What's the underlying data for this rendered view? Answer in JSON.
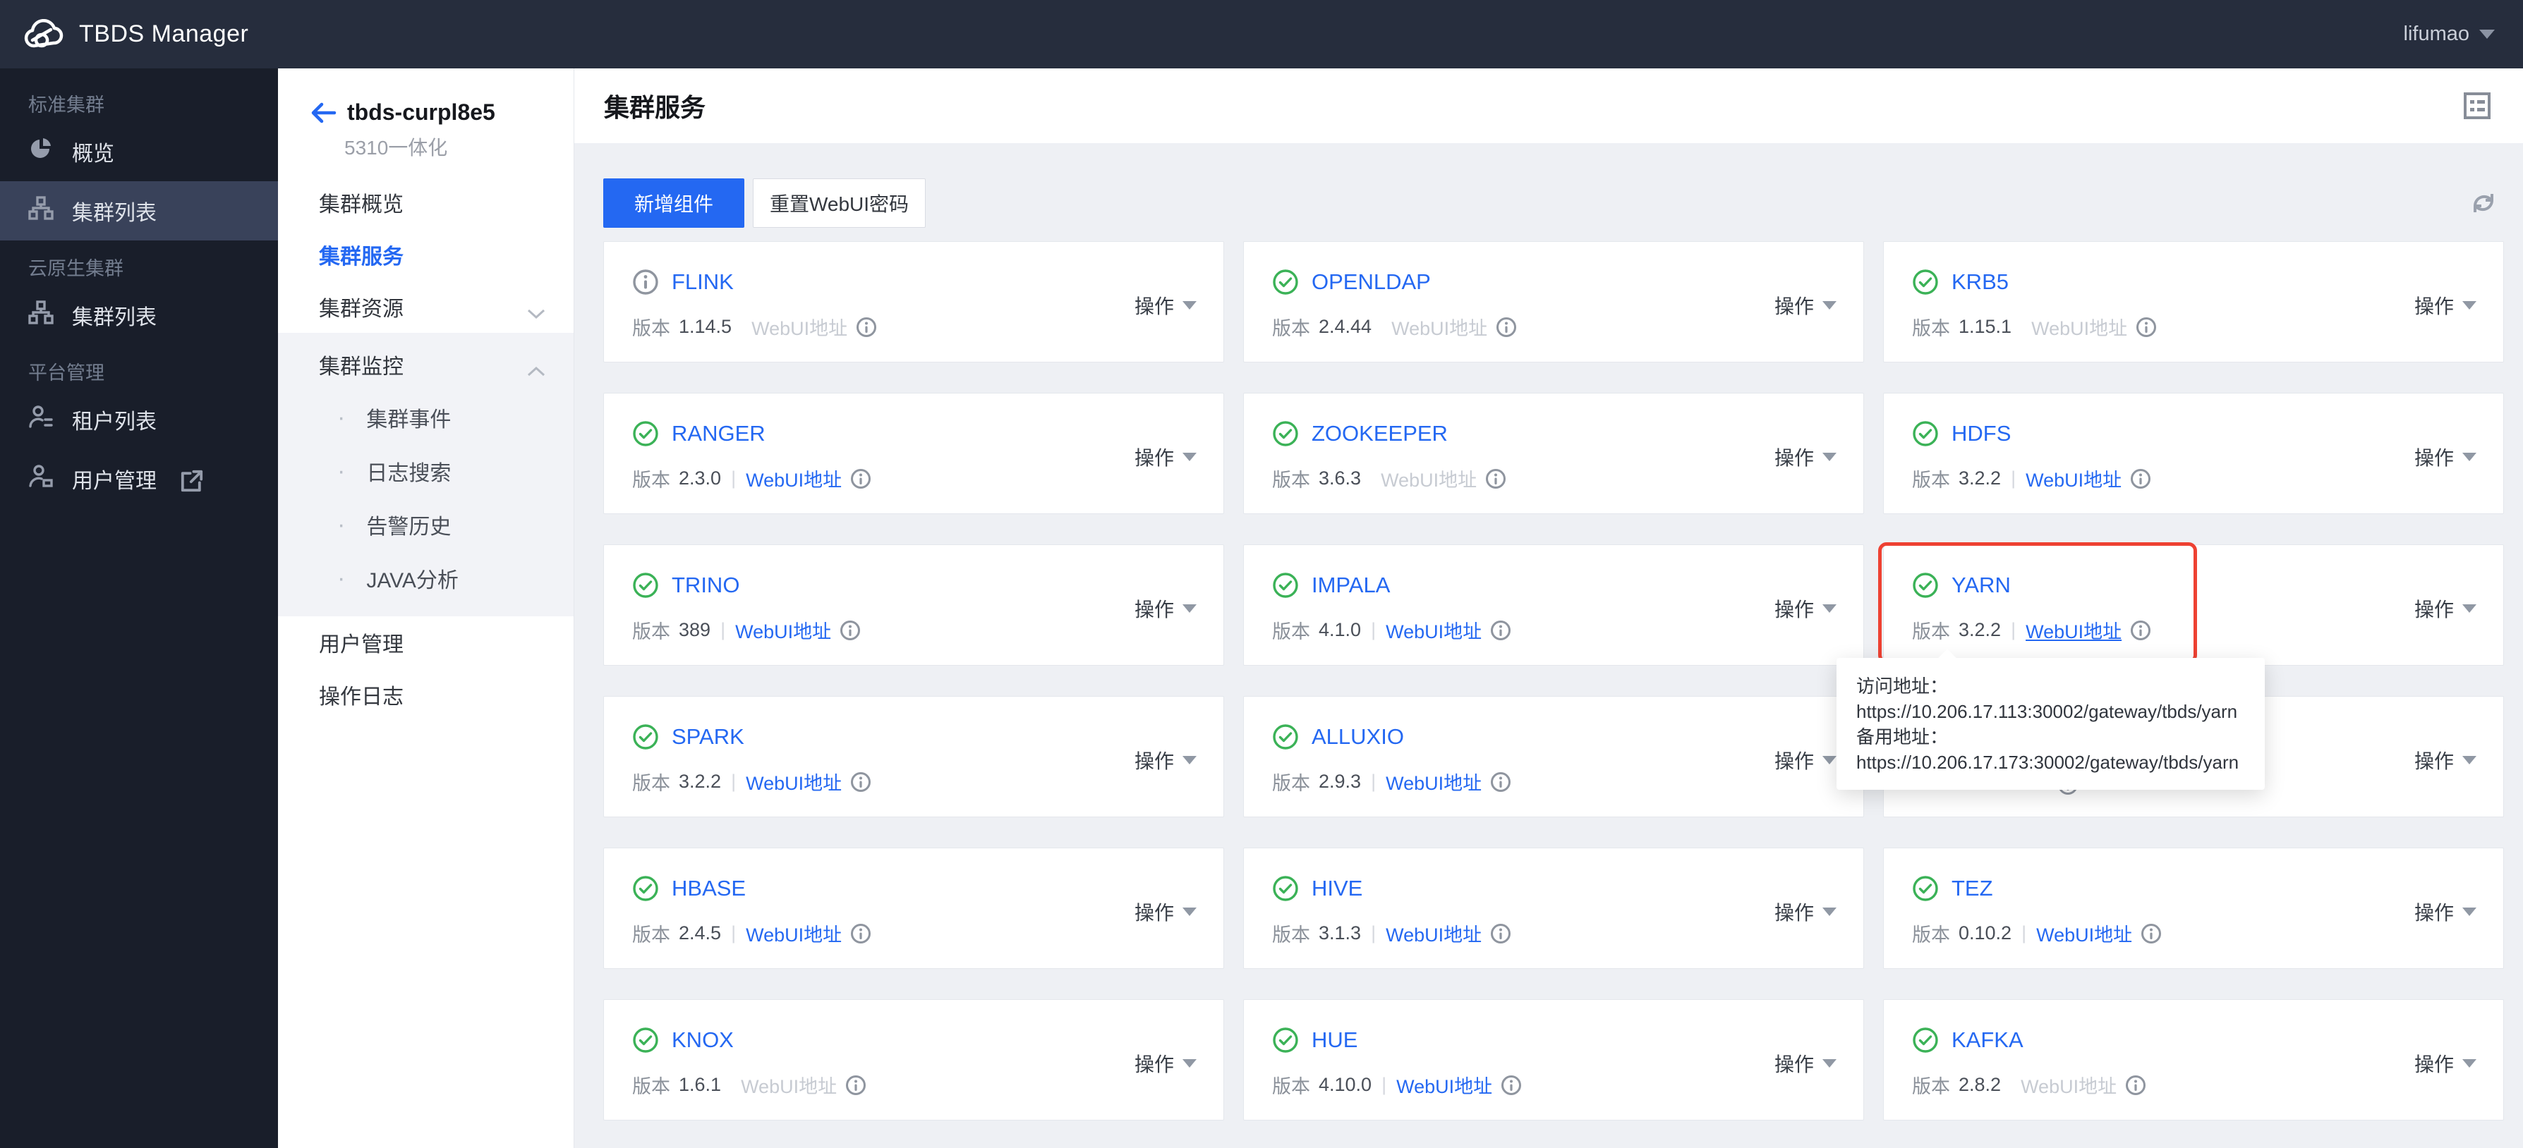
{
  "topbar": {
    "brand": "TBDS Manager",
    "user": "lifumao"
  },
  "sidebar": {
    "sections": [
      {
        "label": "标准集群",
        "items": [
          {
            "label": "概览",
            "icon": "pie-chart-icon",
            "active": false
          },
          {
            "label": "集群列表",
            "icon": "cluster-icon",
            "active": true
          }
        ]
      },
      {
        "label": "云原生集群",
        "items": [
          {
            "label": "集群列表",
            "icon": "cluster-icon",
            "active": false
          }
        ]
      },
      {
        "label": "平台管理",
        "items": [
          {
            "label": "租户列表",
            "icon": "tenant-icon",
            "active": false
          },
          {
            "label": "用户管理",
            "icon": "user-icon",
            "active": false,
            "external": true
          }
        ]
      }
    ]
  },
  "subsidebar": {
    "cluster_name": "tbds-curpl8e5",
    "cluster_subtitle": "5310一体化",
    "items": [
      {
        "label": "集群概览",
        "type": "item",
        "active": false
      },
      {
        "label": "集群服务",
        "type": "item",
        "active": true
      },
      {
        "label": "集群资源",
        "type": "group-collapsed"
      },
      {
        "label": "集群监控",
        "type": "group-expanded",
        "children": [
          "集群事件",
          "日志搜索",
          "告警历史",
          "JAVA分析"
        ]
      },
      {
        "label": "用户管理",
        "type": "item",
        "active": false
      },
      {
        "label": "操作日志",
        "type": "item",
        "active": false
      }
    ]
  },
  "main": {
    "title": "集群服务",
    "add_button": "新增组件",
    "reset_button": "重置WebUI密码",
    "version_label": "版本",
    "webui_label": "WebUI地址",
    "action_label": "操作",
    "cards": [
      {
        "name": "FLINK",
        "status": "info",
        "version": "1.14.5",
        "webui_link": false
      },
      {
        "name": "OPENLDAP",
        "status": "ok",
        "version": "2.4.44",
        "webui_link": false
      },
      {
        "name": "KRB5",
        "status": "ok",
        "version": "1.15.1",
        "webui_link": false
      },
      {
        "name": "RANGER",
        "status": "ok",
        "version": "2.3.0",
        "webui_link": true
      },
      {
        "name": "ZOOKEEPER",
        "status": "ok",
        "version": "3.6.3",
        "webui_link": false
      },
      {
        "name": "HDFS",
        "status": "ok",
        "version": "3.2.2",
        "webui_link": true
      },
      {
        "name": "TRINO",
        "status": "ok",
        "version": "389",
        "webui_link": true
      },
      {
        "name": "IMPALA",
        "status": "ok",
        "version": "4.1.0",
        "webui_link": true
      },
      {
        "name": "YARN",
        "status": "ok",
        "version": "3.2.2",
        "webui_link": true,
        "webui_underline": true,
        "highlighted": true
      },
      {
        "name": "SPARK",
        "status": "ok",
        "version": "3.2.2",
        "webui_link": true
      },
      {
        "name": "ALLUXIO",
        "status": "ok",
        "version": "2.9.3",
        "webui_link": true
      },
      {
        "name": "",
        "status": "covered",
        "version": "",
        "webui_link": false
      },
      {
        "name": "HBASE",
        "status": "ok",
        "version": "2.4.5",
        "webui_link": true
      },
      {
        "name": "HIVE",
        "status": "ok",
        "version": "3.1.3",
        "webui_link": true
      },
      {
        "name": "TEZ",
        "status": "ok",
        "version": "0.10.2",
        "webui_link": true
      },
      {
        "name": "KNOX",
        "status": "ok",
        "version": "1.6.1",
        "webui_link": false
      },
      {
        "name": "HUE",
        "status": "ok",
        "version": "4.10.0",
        "webui_link": true
      },
      {
        "name": "KAFKA",
        "status": "ok",
        "version": "2.8.2",
        "webui_link": false
      }
    ],
    "tooltip": {
      "line1_label": "访问地址：",
      "line1_url": "https://10.206.17.113:30002/gateway/tbds/yarn",
      "line2_label": "备用地址：",
      "line2_url": "https://10.206.17.173:30002/gateway/tbds/yarn"
    }
  },
  "colors": {
    "accent_blue": "#2468f2",
    "status_green": "#3bb257",
    "highlight_red": "#ee4132",
    "topbar_bg": "#262d3d",
    "sidebar_bg": "#191e2a",
    "content_bg": "#eef0f4"
  }
}
